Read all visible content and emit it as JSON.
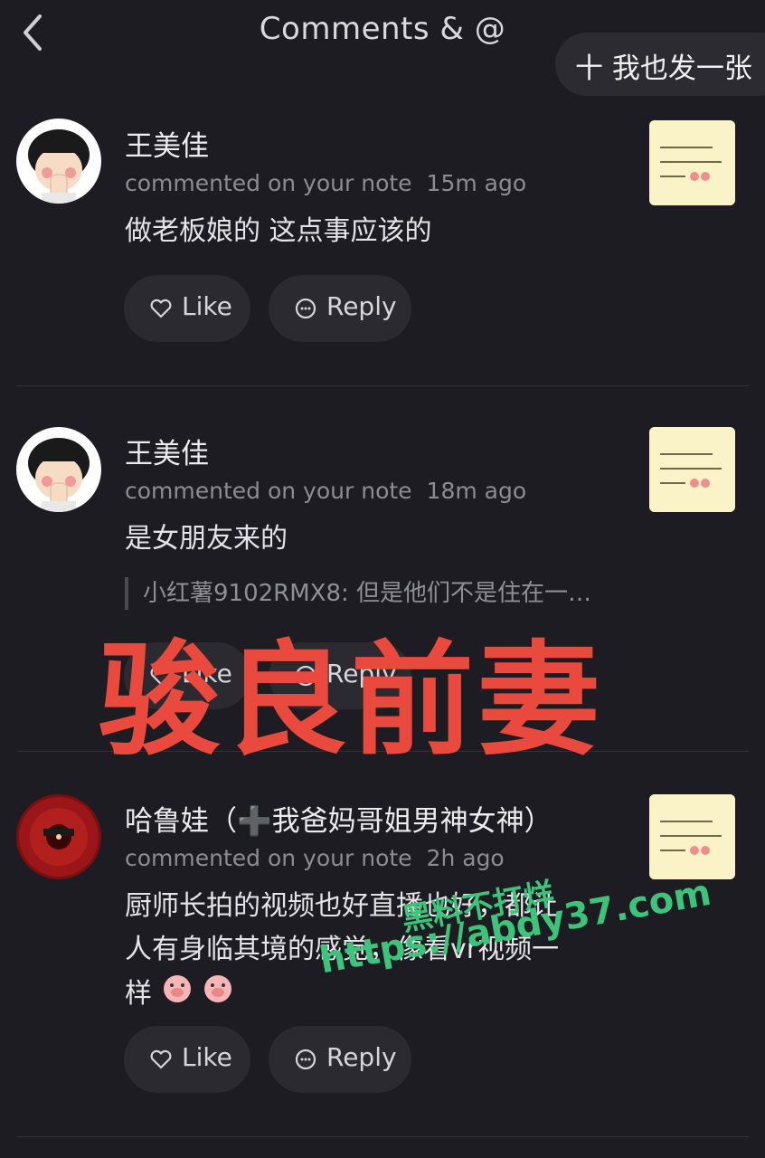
{
  "header": {
    "title": "Comments & @",
    "post_button_label": "十 我也发一张"
  },
  "comments": [
    {
      "username": "王美佳",
      "meta": "commented on your note",
      "time": "15m ago",
      "text": "做老板娘的 这点事应该的",
      "like_label": "Like",
      "reply_label": "Reply"
    },
    {
      "username": "王美佳",
      "meta": "commented on your note",
      "time": "18m ago",
      "text": "是女朋友来的",
      "quote": "小红薯9102RMX8: 但是他们不是住在一…",
      "like_label": "Like",
      "reply_label": "Reply"
    },
    {
      "username": "哈鲁娃（➕我爸妈哥姐男神女神）",
      "meta": "commented on your note",
      "time": "2h ago",
      "text_line1": "厨师长拍的视频也好直播也好，都让",
      "text_line2": "人有身临其境的感觉，像看vr视频一",
      "text_line3": "样",
      "like_label": "Like",
      "reply_label": "Reply"
    }
  ],
  "overlay": {
    "title": "骏良前妻",
    "watermark_line1": "黑料不打烊",
    "watermark_line2": "https://abdy37.com"
  },
  "colors": {
    "background": "#1d1c22",
    "overlay_red": "#e94a3d",
    "watermark_green": "#3cc47a"
  }
}
